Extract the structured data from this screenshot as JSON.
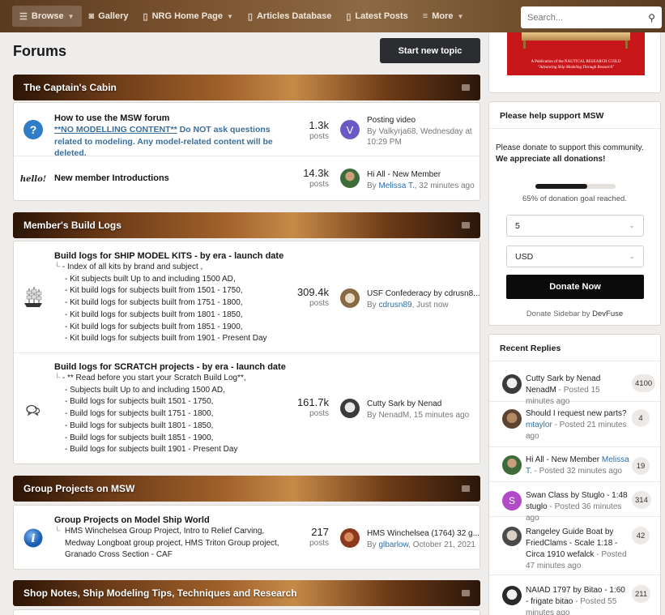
{
  "nav": {
    "browse": "Browse",
    "gallery": "Gallery",
    "nrg_home": "NRG Home Page",
    "articles": "Articles Database",
    "latest_posts": "Latest Posts",
    "more": "More"
  },
  "search": {
    "placeholder": "Search..."
  },
  "page": {
    "title": "Forums",
    "start_topic": "Start new topic"
  },
  "categories": [
    {
      "title": "The Captain's Cabin"
    },
    {
      "title": "Member's Build Logs"
    },
    {
      "title": "Group Projects on MSW"
    },
    {
      "title": "Shop Notes, Ship Modeling Tips, Techniques and Research"
    }
  ],
  "forums": {
    "msw": {
      "title": "How to use the MSW forum",
      "desc_a": "**NO MODELLING CONTENT**",
      "desc_b": " Do NOT ask questions related to modeling. Any model-related content will be deleted.",
      "count": "1.3k",
      "count_label": "posts",
      "last_title": "Posting video",
      "last_by": "By Valkyrja68, Wednesday at 10:29 PM",
      "avatar_letter": "V"
    },
    "intro": {
      "title": "New member Introductions",
      "icon_text": "hello!",
      "count": "14.3k",
      "count_label": "posts",
      "last_title": "Hi All - New Member",
      "last_by_prefix": "By ",
      "last_user": "Melissa T.",
      "last_time": ", 32 minutes ago"
    },
    "kits": {
      "title": "Build logs for SHIP MODEL KITS - by era - launch date",
      "subs": [
        "- Index of all kits by brand and subject ,",
        "- Kit subjects built Up to and including 1500 AD,",
        "- Kit build logs for subjects built from 1501 - 1750,",
        "- Kit build logs for subjects built from 1751 - 1800,",
        "- Kit build logs for subjects built from 1801 - 1850,",
        "- Kit build logs for subjects built from 1851 - 1900,",
        "- Kit build logs for subjects built from 1901 - Present Day"
      ],
      "count": "309.4k",
      "count_label": "posts",
      "last_title": "USF Confederacy by cdrusn8...",
      "last_by_prefix": "By ",
      "last_user": "cdrusn89",
      "last_time": ", Just now"
    },
    "scratch": {
      "title": "Build logs for SCRATCH projects - by era - launch date",
      "subs": [
        "- ** Read before you start your Scratch Build Log**,",
        "- Subjects built Up to and including 1500 AD,",
        "- Build logs for subjects built 1501 - 1750,",
        "- Build logs for subjects built 1751 - 1800,",
        "- Build logs for subjects built 1801 - 1850,",
        "- Build logs for subjects built 1851 - 1900,",
        "- Build logs for subjects built 1901 - Present Day"
      ],
      "count": "161.7k",
      "count_label": "posts",
      "last_title": "Cutty Sark by Nenad",
      "last_by": "By NenadM, 15 minutes ago"
    },
    "group": {
      "title": "Group Projects on Model Ship World",
      "subs_text": "HMS Winchelsea Group Project,  Intro to Relief Carving, Medway Longboat group project,  HMS Triton Group project, Granado Cross Section - CAF",
      "count": "217",
      "count_label": "posts",
      "last_title": "HMS Winchelsea (1764) 32 g...",
      "last_by_prefix": "By ",
      "last_user": "glbarlow",
      "last_time": ", October 21, 2021"
    }
  },
  "ad": {
    "line1": "A Publication of the NAUTICAL RESEARCH GUILD",
    "line2": "\"Advancing Ship Modeling Through Research\""
  },
  "donate": {
    "heading": "Please help support MSW",
    "text": "Please donate to support this community. ",
    "text_bold": "We appreciate all donations!",
    "progress": 0.65,
    "progress_text": "65% of donation goal reached.",
    "amount": "5",
    "currency": "USD",
    "button": "Donate Now",
    "footer_a": "Donate Sidebar by ",
    "footer_b": "DevFuse"
  },
  "recent": {
    "heading": "Recent Replies",
    "items": [
      {
        "title": "Cutty Sark by Nenad NenadM",
        "meta": " - Posted 15 minutes ago",
        "count": "4100"
      },
      {
        "title": "Should I request new parts?",
        "user": "mtaylor",
        "meta": " - Posted 21 minutes ago",
        "count": "4"
      },
      {
        "title": "Hi All - New Member ",
        "user": "Melissa T.",
        "meta": " - Posted 32 minutes ago",
        "count": "19"
      },
      {
        "title": "Swan Class by Stuglo - 1:48 stuglo",
        "meta": " - Posted 36 minutes ago",
        "count": "314",
        "avatar_letter": "S"
      },
      {
        "title": "Rangeley Guide Boat by FriedClams - Scale 1:18 - Circa 1910 wefalck",
        "meta": " - Posted 47 minutes ago",
        "count": "42"
      },
      {
        "title": "NAIAD 1797 by Bitao - 1:60 - frigate bitao",
        "meta": " - Posted 55 minutes ago",
        "count": "211"
      }
    ]
  },
  "colors": {
    "accent": "#2b2d30",
    "link": "#2f6ea7",
    "donate_button": "#0b0b0b"
  }
}
